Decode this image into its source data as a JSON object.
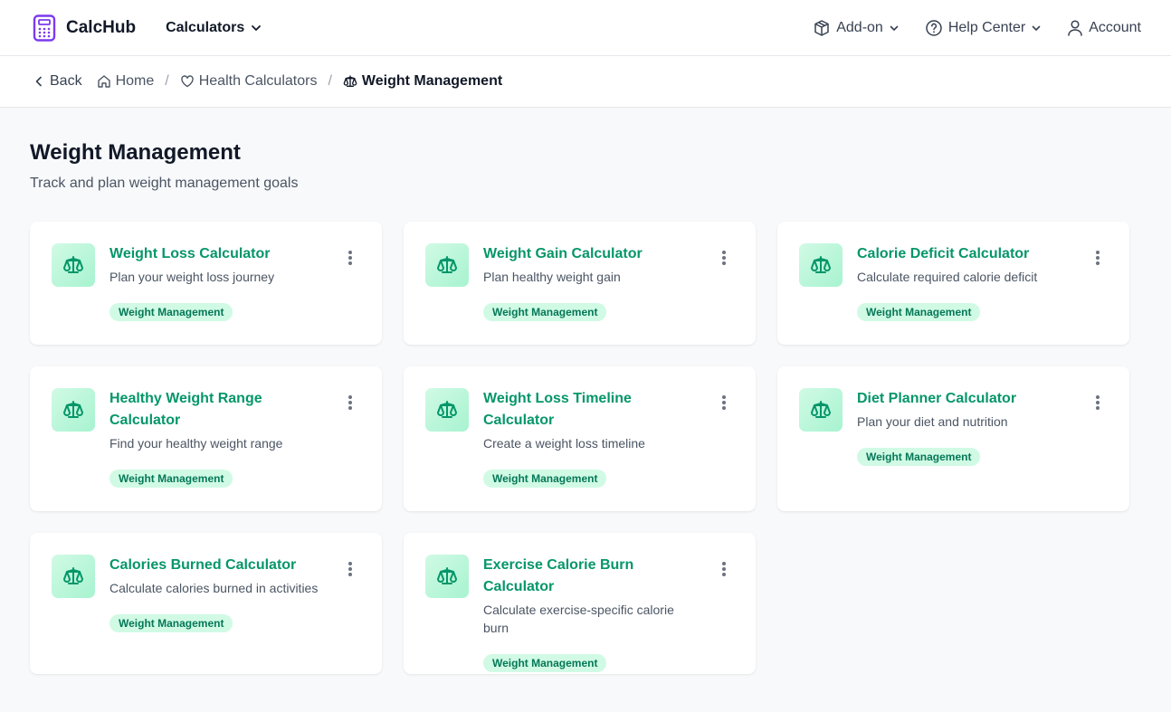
{
  "brand": {
    "name": "CalcHub",
    "accent": "#7c3aed"
  },
  "topnav": {
    "calculators_label": "Calculators",
    "addon_label": "Add-on",
    "help_label": "Help Center",
    "account_label": "Account"
  },
  "breadcrumb": {
    "back_label": "Back",
    "home_label": "Home",
    "category_label": "Health Calculators",
    "current_label": "Weight Management",
    "separator": "/"
  },
  "page": {
    "title": "Weight Management",
    "subtitle": "Track and plan weight management goals"
  },
  "colors": {
    "title_green": "#059669",
    "badge_bg": "#d1fae5",
    "badge_text": "#047857"
  },
  "cards": [
    {
      "title": "Weight Loss Calculator",
      "description": "Plan your weight loss journey",
      "tag": "Weight Management",
      "icon": "scale-icon"
    },
    {
      "title": "Weight Gain Calculator",
      "description": "Plan healthy weight gain",
      "tag": "Weight Management",
      "icon": "scale-icon"
    },
    {
      "title": "Calorie Deficit Calculator",
      "description": "Calculate required calorie deficit",
      "tag": "Weight Management",
      "icon": "scale-icon"
    },
    {
      "title": "Healthy Weight Range Calculator",
      "description": "Find your healthy weight range",
      "tag": "Weight Management",
      "icon": "scale-icon"
    },
    {
      "title": "Weight Loss Timeline Calculator",
      "description": "Create a weight loss timeline",
      "tag": "Weight Management",
      "icon": "scale-icon"
    },
    {
      "title": "Diet Planner Calculator",
      "description": "Plan your diet and nutrition",
      "tag": "Weight Management",
      "icon": "scale-icon"
    },
    {
      "title": "Calories Burned Calculator",
      "description": "Calculate calories burned in activities",
      "tag": "Weight Management",
      "icon": "scale-icon"
    },
    {
      "title": "Exercise Calorie Burn Calculator",
      "description": "Calculate exercise-specific calorie burn",
      "tag": "Weight Management",
      "icon": "scale-icon"
    }
  ]
}
